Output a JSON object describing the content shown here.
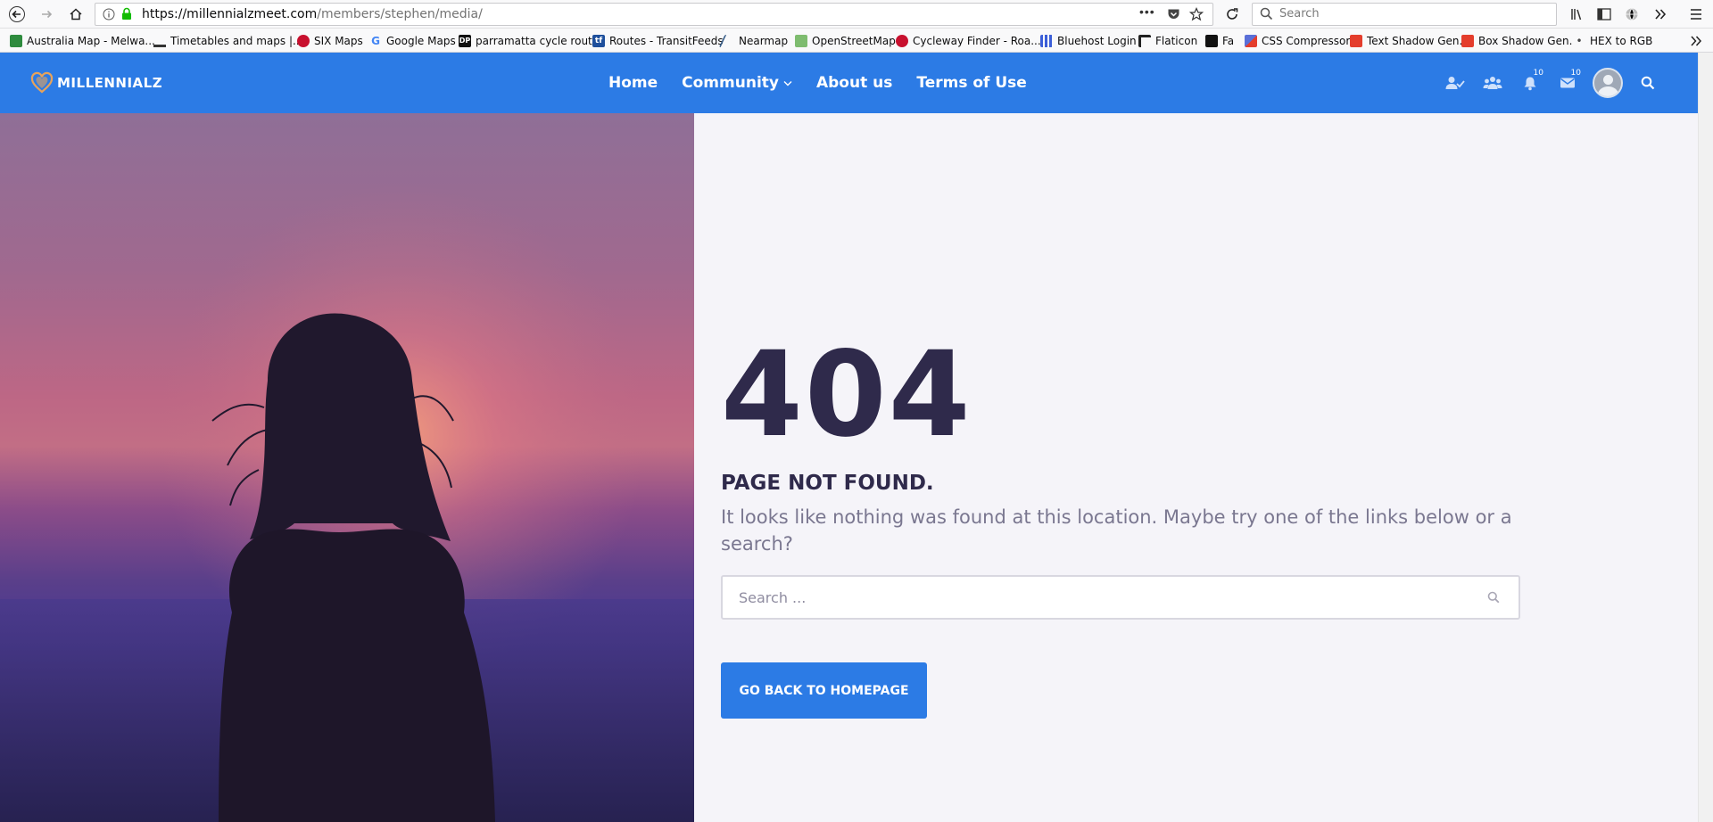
{
  "browser": {
    "url_domain": "https://millennialzmeet.com",
    "url_path": "/members/stephen/media/",
    "search_placeholder": "Search",
    "bookmarks": [
      {
        "label": "Australia Map - Melwa...",
        "color": "#2e8b3e"
      },
      {
        "label": "Timetables and maps |...",
        "color": "#333333"
      },
      {
        "label": "SIX Maps",
        "color": "#c8102e"
      },
      {
        "label": "Google Maps",
        "color": "#4285f4"
      },
      {
        "label": "parramatta cycle route",
        "color": "#111111"
      },
      {
        "label": "Routes - TransitFeeds",
        "color": "#1e4f9c"
      },
      {
        "label": "Nearmap",
        "color": "#3a5f8a"
      },
      {
        "label": "OpenStreetMap",
        "color": "#7ebc6f"
      },
      {
        "label": "Cycleway Finder - Roa...",
        "color": "#c8102e"
      },
      {
        "label": "Bluehost Login",
        "color": "#3b5ed8"
      },
      {
        "label": "Flaticon",
        "color": "#222222"
      },
      {
        "label": "Fa",
        "color": "#111111"
      },
      {
        "label": "CSS Compressor",
        "color": "#5a6fd8"
      },
      {
        "label": "Text Shadow Gen.",
        "color": "#e43d2c"
      },
      {
        "label": "Box Shadow Gen.",
        "color": "#e43d2c"
      },
      {
        "label": "HEX to RGB",
        "color": "#444444"
      }
    ]
  },
  "header": {
    "logo_text": "MILLENNIALZ",
    "nav": [
      "Home",
      "Community",
      "About us",
      "Terms of Use"
    ],
    "notification_count": "10",
    "message_count": "10"
  },
  "error": {
    "code": "404",
    "title": "PAGE NOT FOUND.",
    "message": "It looks like nothing was found at this location. Maybe try one of the links below or a search?",
    "search_placeholder": "Search ...",
    "button_label": "GO BACK TO HOMEPAGE"
  },
  "colors": {
    "accent": "#2c7be5",
    "heading": "#2f2a4b",
    "body_text": "#7a7790",
    "background": "#f5f4f9"
  }
}
